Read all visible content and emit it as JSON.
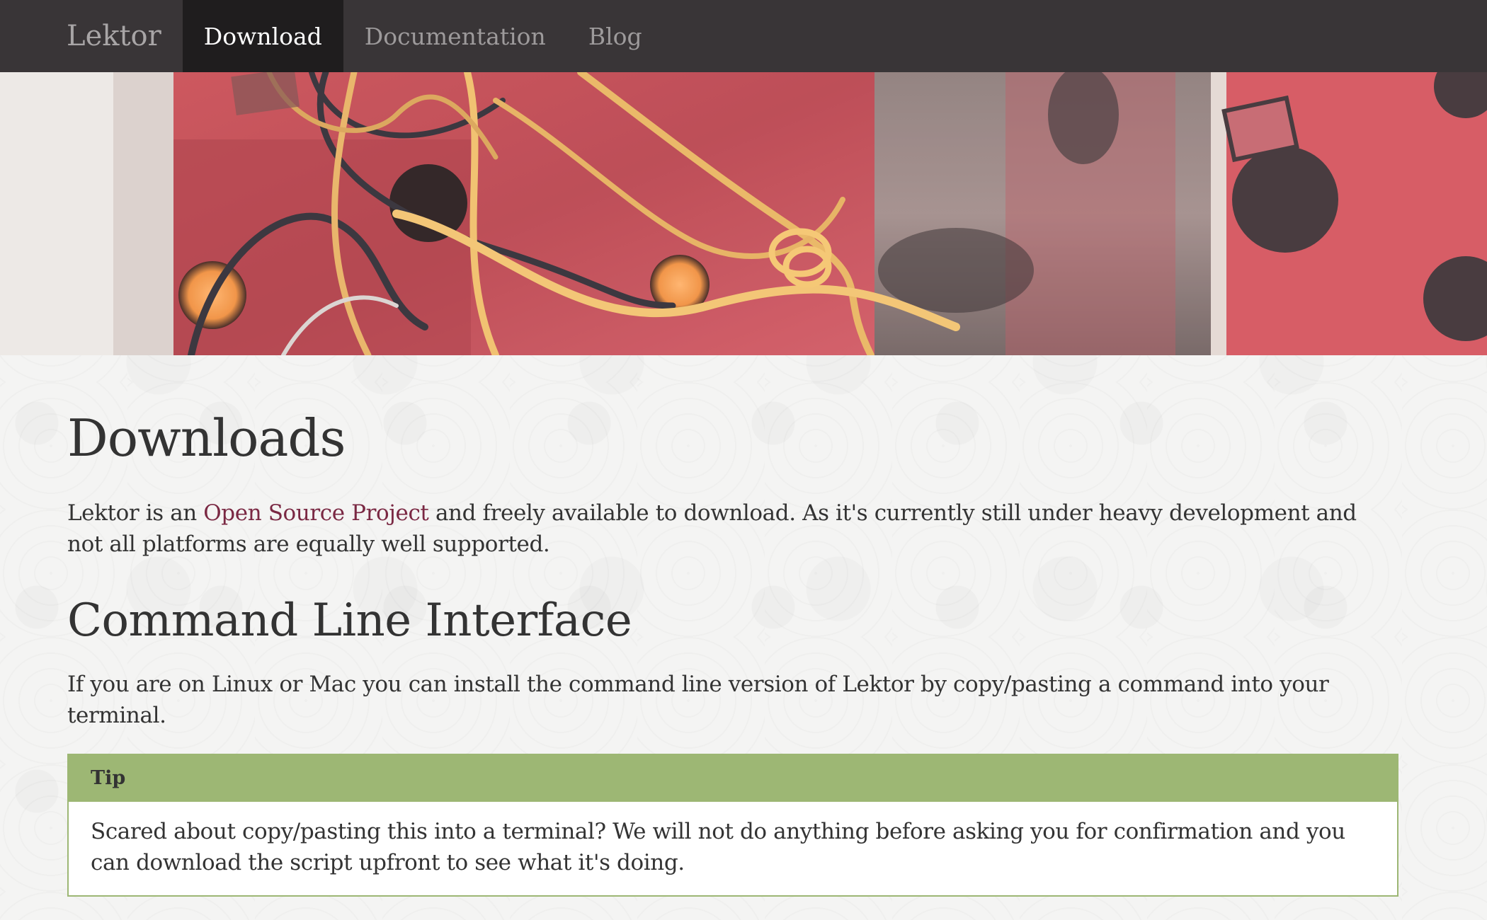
{
  "navbar": {
    "brand": "Lektor",
    "items": [
      {
        "label": "Download",
        "active": true
      },
      {
        "label": "Documentation",
        "active": false
      },
      {
        "label": "Blog",
        "active": false
      }
    ]
  },
  "hero": {
    "icon": "wires-photo-banner"
  },
  "main": {
    "title": "Downloads",
    "intro_before": "Lektor is an ",
    "intro_link": "Open Source Project",
    "intro_after": " and freely available to download. As it's currently still under heavy development and not all platforms are equally well supported.",
    "cli_heading": "Command Line Interface",
    "cli_text": "If you are on Linux or Mac you can install the command line version of Lektor by copy/pasting a command into your terminal.",
    "tip": {
      "label": "Tip",
      "text": "Scared about copy/pasting this into a terminal? We will not do anything before asking you for confirmation and you can download the script upfront to see what it's doing."
    }
  },
  "colors": {
    "navbar_bg": "#393537",
    "navbar_active_bg": "#1f1d1e",
    "link": "#7a2843",
    "tip_green": "#9db774"
  }
}
